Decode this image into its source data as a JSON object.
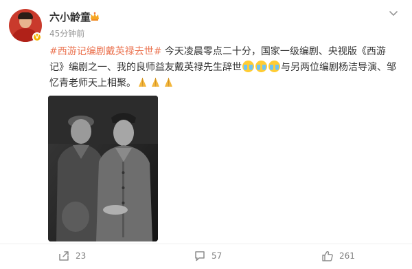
{
  "author": {
    "name": "六小龄童",
    "verified_mark": "V"
  },
  "post": {
    "time": "45分钟前",
    "hashtag": "#西游记编剧戴英禄去世#",
    "text_a": " 今天凌晨零点二十分，国家一级编剧、央视版《西游记》编剧之一、我的良师益友戴英禄先生辞世",
    "text_b": "与另两位编剧杨洁导演、邹忆青老师天上相聚。"
  },
  "icons": {
    "crown": "crown-icon",
    "menu": "chevron-down-icon",
    "cry": "crying-emoji-icon",
    "pray": "pray-emoji-icon",
    "repost": "repost-icon",
    "comment": "comment-icon",
    "like": "like-icon"
  },
  "stats": {
    "reposts": "23",
    "comments": "57",
    "likes": "261"
  },
  "colors": {
    "hashtag": "#eb7350",
    "text": "#333333",
    "meta": "#939393",
    "icon": "#8c8c8c"
  }
}
